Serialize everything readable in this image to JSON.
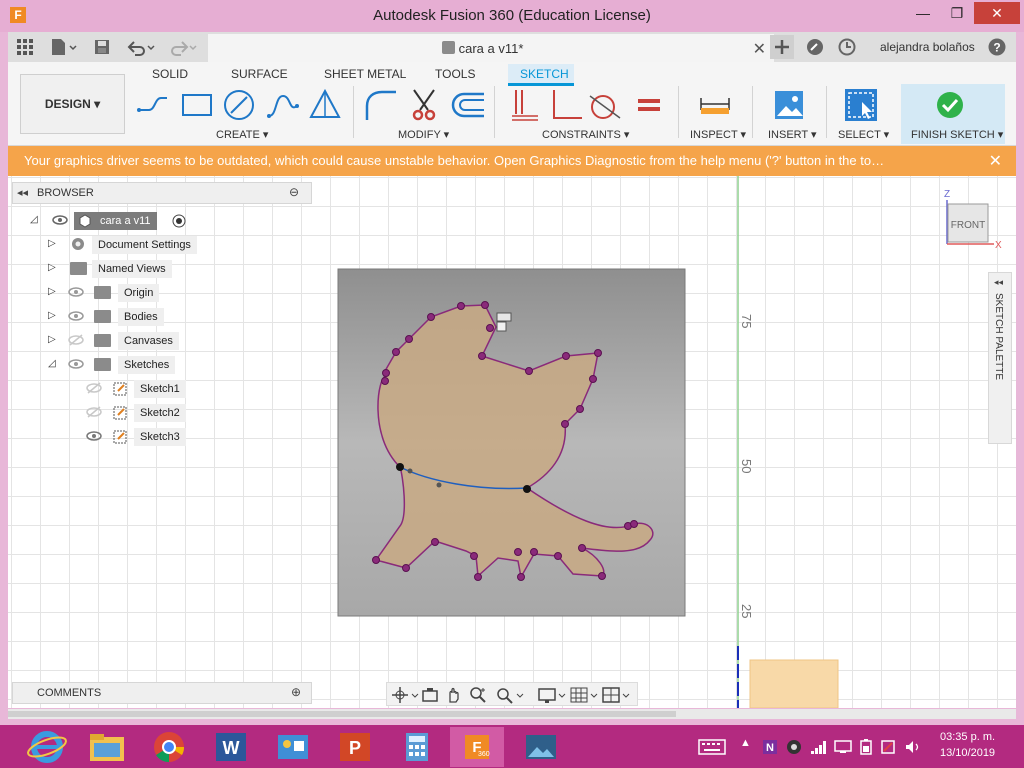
{
  "window": {
    "title": "Autodesk Fusion 360 (Education License)",
    "logo": "F"
  },
  "tabbar": {
    "doc_tab_label": "cara a v11*",
    "user_name": "alejandra bolaños"
  },
  "ribbon": {
    "workspace": "DESIGN ▾",
    "tabs": [
      "SOLID",
      "SURFACE",
      "SHEET METAL",
      "TOOLS",
      "SKETCH"
    ],
    "active_tab": "SKETCH",
    "groups": {
      "create": "CREATE ▾",
      "modify": "MODIFY ▾",
      "constraints": "CONSTRAINTS ▾",
      "inspect": "INSPECT ▾",
      "insert": "INSERT ▾",
      "select": "SELECT ▾",
      "finish": "FINISH SKETCH ▾"
    }
  },
  "banner": {
    "text": "Your graphics driver seems to be outdated, which could cause unstable behavior. Open Graphics Diagnostic from the help menu ('?' button in the to…",
    "close": "✕"
  },
  "browser": {
    "title": "BROWSER",
    "root": "cara a v11",
    "items": [
      {
        "label": "Document Settings"
      },
      {
        "label": "Named Views"
      },
      {
        "label": "Origin"
      },
      {
        "label": "Bodies"
      },
      {
        "label": "Canvases"
      },
      {
        "label": "Sketches"
      },
      {
        "label": "Sketch1"
      },
      {
        "label": "Sketch2"
      },
      {
        "label": "Sketch3"
      }
    ]
  },
  "comments": {
    "title": "COMMENTS"
  },
  "ruler": {
    "ticks": [
      "75",
      "50",
      "25"
    ]
  },
  "viewcube": {
    "face": "FRONT",
    "axis_z": "Z",
    "axis_x": "X"
  },
  "palette": {
    "label": "SKETCH PALETTE"
  },
  "taskbar": {
    "time": "03:35 p. m.",
    "date": "13/10/2019",
    "fusion_badge": "360"
  },
  "colors": {
    "accent": "#0696d7",
    "banner": "#f5a44a",
    "profile_fill": "#c8a984",
    "profile_line": "#8a2a7a",
    "selected_line": "#1f5fbf",
    "titlebar": "#e6aed3",
    "taskbar": "#b32a80"
  },
  "icons": [
    "grid-icon",
    "file-icon",
    "save-icon",
    "undo-icon",
    "redo-icon",
    "cube-icon",
    "plus-icon",
    "job-status-icon",
    "clock-icon",
    "help-icon",
    "line-icon",
    "rectangle-icon",
    "circle-icon",
    "spline-icon",
    "polygon-icon",
    "fillet-icon",
    "trim-icon",
    "offset-icon",
    "coincident-icon",
    "perpendicular-icon",
    "tangent-icon",
    "equal-icon",
    "measure-icon",
    "image-icon",
    "select-icon",
    "check-icon",
    "eye-icon",
    "gear-icon",
    "folder-icon"
  ]
}
